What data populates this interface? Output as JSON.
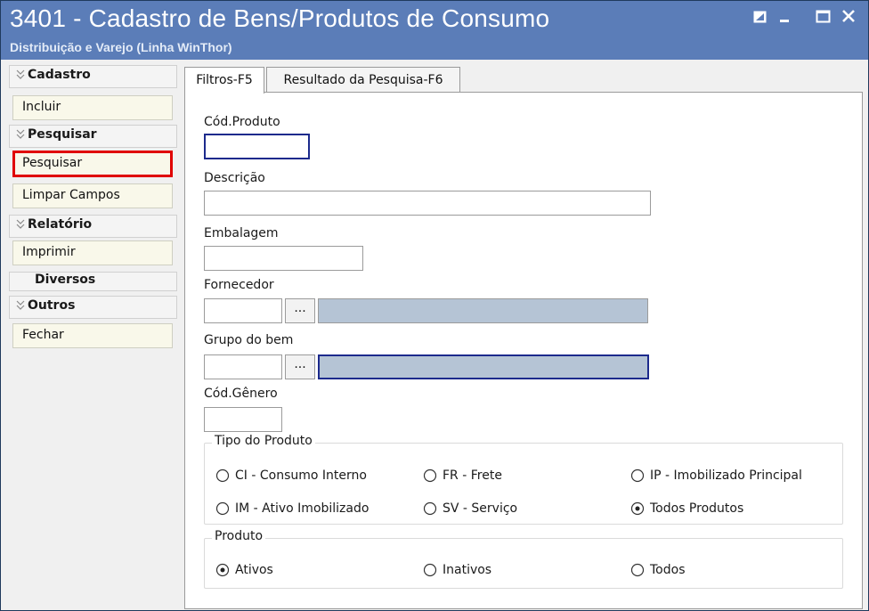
{
  "window": {
    "title": "3401 - Cadastro de Bens/Produtos de Consumo",
    "subtitle": "Distribuição e Varejo (Linha WinThor)"
  },
  "sidebar": {
    "groups": [
      {
        "label": "Cadastro",
        "items": [
          {
            "label": "Incluir"
          }
        ]
      },
      {
        "label": "Pesquisar",
        "items": [
          {
            "label": "Pesquisar",
            "highlighted": true
          },
          {
            "label": "Limpar Campos"
          }
        ]
      },
      {
        "label": "Relatório",
        "items": [
          {
            "label": "Imprimir"
          }
        ]
      },
      {
        "label": "Diversos",
        "items": []
      },
      {
        "label": "Outros",
        "items": [
          {
            "label": "Fechar"
          }
        ]
      }
    ]
  },
  "tabs": [
    {
      "label": "Filtros-F5",
      "active": true
    },
    {
      "label": "Resultado da Pesquisa-F6",
      "active": false
    }
  ],
  "form": {
    "cod_produto": {
      "label": "Cód.Produto",
      "value": ""
    },
    "descricao": {
      "label": "Descrição",
      "value": ""
    },
    "embalagem": {
      "label": "Embalagem",
      "value": ""
    },
    "fornecedor": {
      "label": "Fornecedor",
      "code": "",
      "name": "",
      "button": "..."
    },
    "grupo_bem": {
      "label": "Grupo do bem",
      "code": "",
      "name": "",
      "button": "..."
    },
    "cod_genero": {
      "label": "Cód.Gênero",
      "value": ""
    },
    "tipo_produto": {
      "legend": "Tipo do Produto",
      "options": [
        {
          "label": "CI - Consumo Interno",
          "selected": false
        },
        {
          "label": "FR - Frete",
          "selected": false
        },
        {
          "label": "IP - Imobilizado Principal",
          "selected": false
        },
        {
          "label": "IM - Ativo Imobilizado",
          "selected": false
        },
        {
          "label": "SV - Serviço",
          "selected": false
        },
        {
          "label": "Todos Produtos",
          "selected": true
        }
      ]
    },
    "produto": {
      "legend": "Produto",
      "options": [
        {
          "label": "Ativos",
          "selected": true
        },
        {
          "label": "Inativos",
          "selected": false
        },
        {
          "label": "Todos",
          "selected": false
        }
      ]
    }
  },
  "colors": {
    "titlebar": "#5b7db8",
    "item_bg": "#f9f8ea",
    "highlight": "#e00000",
    "lookup_bg": "#b5c4d5",
    "focus_border": "#1c2a8c"
  }
}
